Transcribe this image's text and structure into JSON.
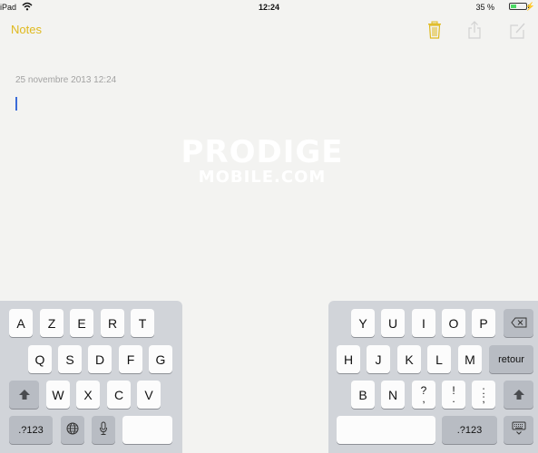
{
  "status_bar": {
    "carrier": "iPad",
    "wifi_icon": "wifi-icon",
    "time": "12:24",
    "battery_percent_label": "35 %",
    "battery_level": 0.35,
    "charging_icon": "bolt-icon"
  },
  "nav": {
    "back_label": "Notes",
    "accent_color": "#dfb91d",
    "actions": [
      "trash-icon",
      "share-icon",
      "compose-icon"
    ]
  },
  "note": {
    "date": "25 novembre 2013 12:24",
    "body": ""
  },
  "watermark": {
    "line1": "PRODIGE",
    "line2": "MOBILE.COM"
  },
  "keyboard": {
    "left": {
      "row1": [
        "A",
        "Z",
        "E",
        "R",
        "T"
      ],
      "row2": [
        "Q",
        "S",
        "D",
        "F",
        "G"
      ],
      "row3": [
        "W",
        "X",
        "C",
        "V"
      ],
      "numbers_label": ".?123"
    },
    "right": {
      "row1": [
        "Y",
        "U",
        "I",
        "O",
        "P"
      ],
      "row2": [
        "H",
        "J",
        "K",
        "L",
        "M"
      ],
      "return_label": "retour",
      "row3": [
        "B",
        "N"
      ],
      "punct": [
        {
          "top": "?",
          "bottom": ","
        },
        {
          "top": "!",
          "bottom": "."
        },
        {
          "top": ":",
          "bottom": ";"
        }
      ],
      "numbers_label": ".?123"
    }
  }
}
